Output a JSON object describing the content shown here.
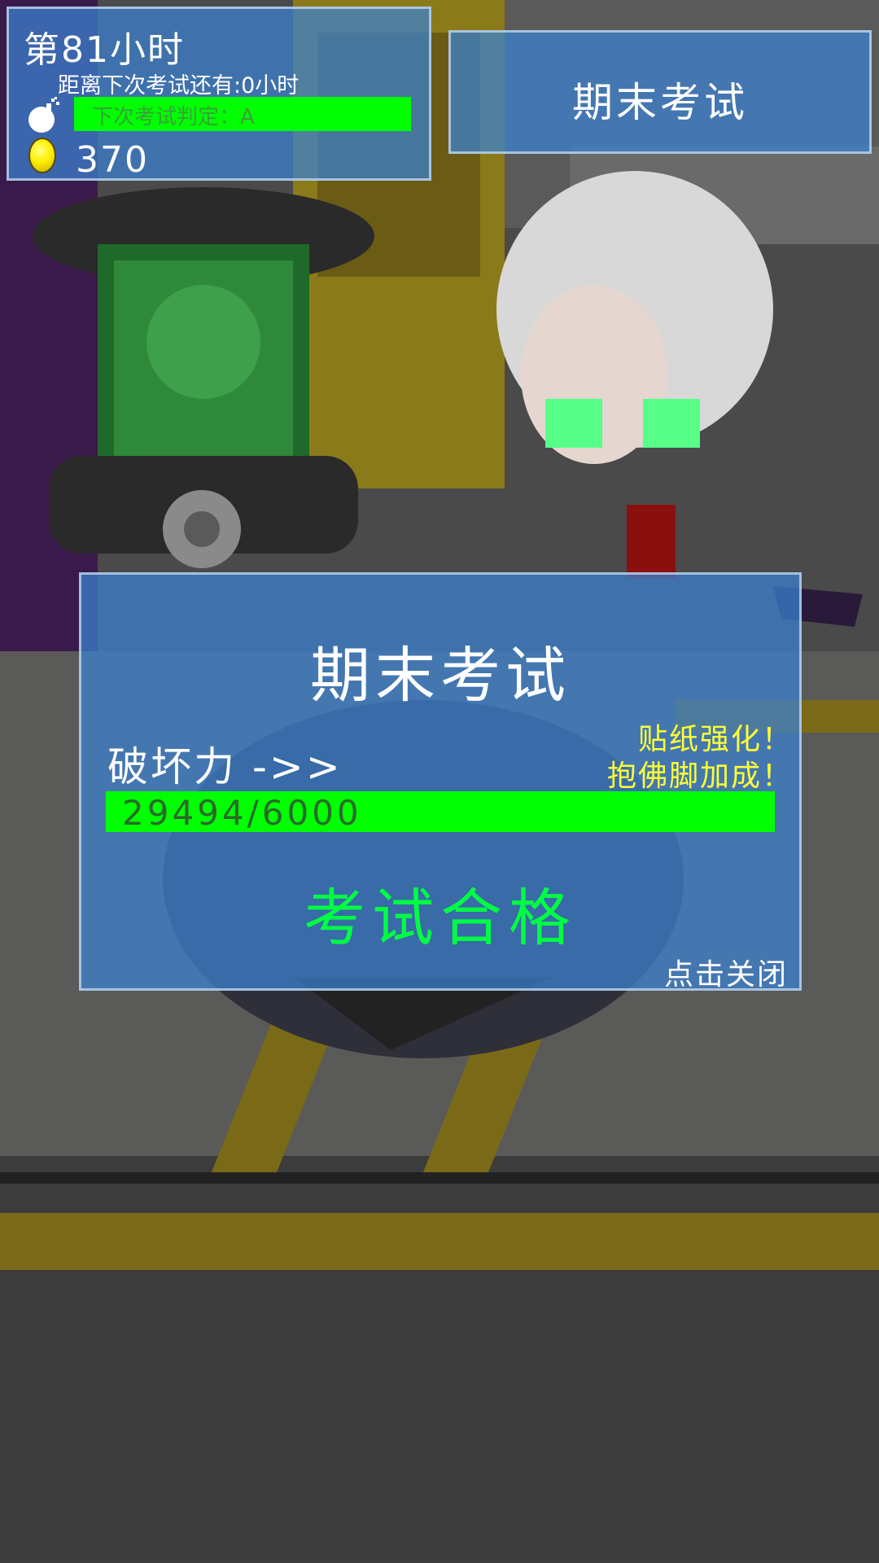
{
  "hud": {
    "hour_title": "第81小时",
    "countdown": "距离下次考试还有:0小时",
    "next_grade": "下次考试判定：A",
    "coins": "370",
    "bomb_icon": "bomb-icon",
    "coin_icon": "gold-coin-icon"
  },
  "exam_button": {
    "label": "期末考试"
  },
  "result_dialog": {
    "title": "期末考试",
    "power_label": "破坏力 ->>",
    "bonus_lines": [
      "贴纸强化！",
      "抱佛脚加成！"
    ],
    "power_value": "29494/6000",
    "power_fill_fraction": 1.0,
    "result": "考试合格",
    "close_hint": "点击关闭"
  },
  "colors": {
    "panel_blue": "#3c82d2",
    "bar_green": "#00ff00",
    "result_green": "#00ff44",
    "bonus_yellow": "#ffff33"
  }
}
